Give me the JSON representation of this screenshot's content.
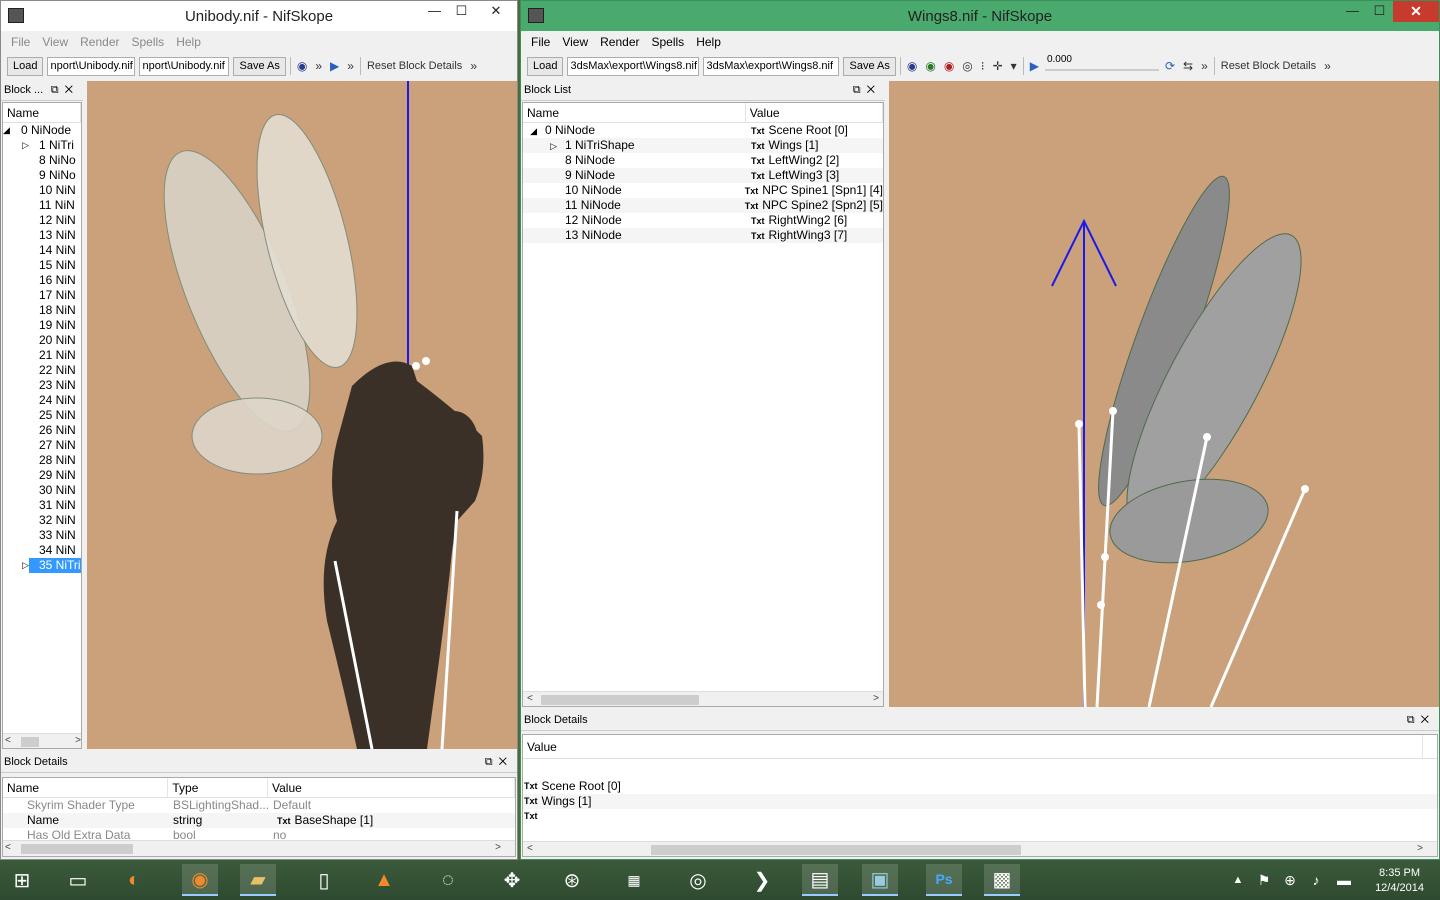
{
  "left": {
    "title": "Unibody.nif - NifSkope",
    "menu": [
      "File",
      "View",
      "Render",
      "Spells",
      "Help"
    ],
    "toolbar": {
      "load": "Load",
      "path1": "nport\\Unibody.nif",
      "path2": "nport\\Unibody.nif",
      "save_as": "Save As",
      "reset": "Reset Block Details"
    },
    "block_list_title": "Block ...",
    "col_name": "Name",
    "nodes": [
      "0 NiNode",
      "1 NiTri",
      "8 NiNo",
      "9 NiNo",
      "10 NiN",
      "11 NiN",
      "12 NiN",
      "13 NiN",
      "14 NiN",
      "15 NiN",
      "16 NiN",
      "17 NiN",
      "18 NiN",
      "19 NiN",
      "20 NiN",
      "21 NiN",
      "22 NiN",
      "23 NiN",
      "24 NiN",
      "25 NiN",
      "26 NiN",
      "27 NiN",
      "28 NiN",
      "29 NiN",
      "30 NiN",
      "31 NiN",
      "32 NiN",
      "33 NiN",
      "34 NiN",
      "35 NiTri"
    ],
    "details_title": "Block Details",
    "details_cols": [
      "Name",
      "Type",
      "Value"
    ],
    "details_rows": [
      {
        "name": "Skyrim Shader Type",
        "type": "BSLightingShad...",
        "value": "Default"
      },
      {
        "name": "Name",
        "type": "string",
        "value": "BaseShape [1]"
      },
      {
        "name": "Has Old Extra Data",
        "type": "bool",
        "value": "no"
      }
    ]
  },
  "right": {
    "title": "Wings8.nif - NifSkope",
    "menu": [
      "File",
      "View",
      "Render",
      "Spells",
      "Help"
    ],
    "toolbar": {
      "load": "Load",
      "path1": "3dsMax\\export\\Wings8.nif",
      "path2": "3dsMax\\export\\Wings8.nif",
      "save_as": "Save As",
      "time": "0.000",
      "reset": "Reset Block Details"
    },
    "block_list_title": "Block List",
    "cols": [
      "Name",
      "Value"
    ],
    "rows": [
      {
        "name": "0 NiNode",
        "value": "Scene Root [0]"
      },
      {
        "name": "1 NiTriShape",
        "value": "Wings [1]"
      },
      {
        "name": "8 NiNode",
        "value": "LeftWing2 [2]"
      },
      {
        "name": "9 NiNode",
        "value": "LeftWing3 [3]"
      },
      {
        "name": "10 NiNode",
        "value": "NPC Spine1 [Spn1] [4]"
      },
      {
        "name": "11 NiNode",
        "value": "NPC Spine2 [Spn2] [5]"
      },
      {
        "name": "12 NiNode",
        "value": "RightWing2 [6]"
      },
      {
        "name": "13 NiNode",
        "value": "RightWing3 [7]"
      }
    ],
    "txt_tag": "Txt",
    "details_title": "Block Details",
    "details_col": "Value",
    "details_rows": [
      "Scene Root [0]",
      "Wings [1]",
      ""
    ]
  },
  "clock": {
    "time": "8:35 PM",
    "date": "12/4/2014"
  },
  "colors": {
    "viewport": "#caa17a",
    "title_active": "#4aa96c",
    "taskbar": "#2e4a30"
  }
}
